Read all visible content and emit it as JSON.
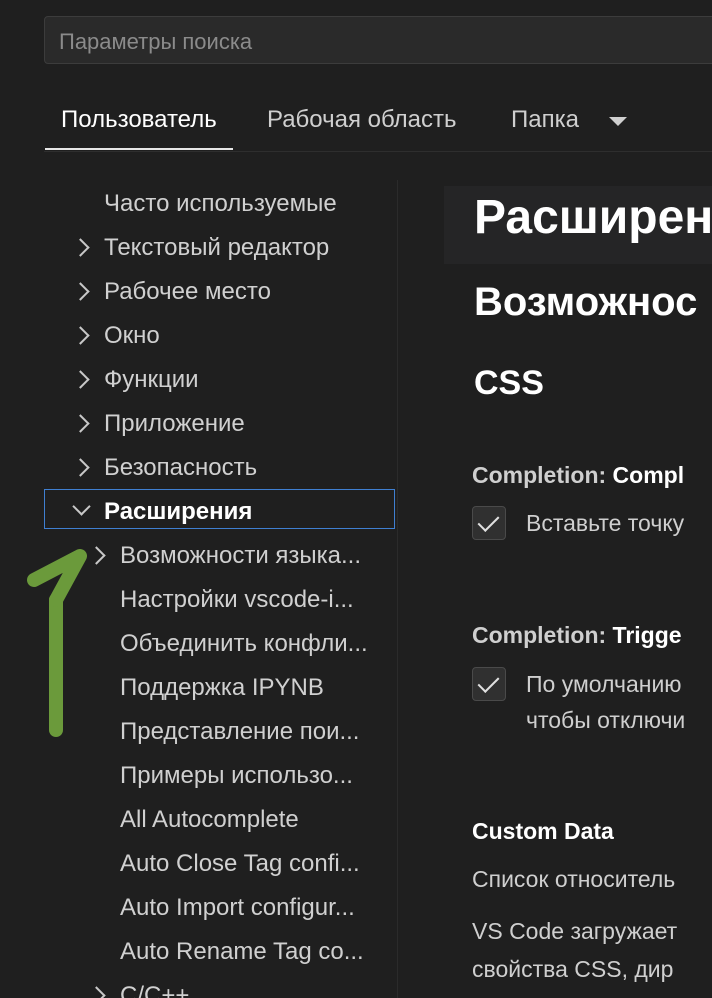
{
  "search": {
    "placeholder": "Параметры поиска"
  },
  "tabs": [
    {
      "label": "Пользователь"
    },
    {
      "label": "Рабочая область"
    },
    {
      "label": "Папка"
    }
  ],
  "tree": {
    "items": [
      {
        "label": "Часто используемые"
      },
      {
        "label": "Текстовый редактор"
      },
      {
        "label": "Рабочее место"
      },
      {
        "label": "Окно"
      },
      {
        "label": "Функции"
      },
      {
        "label": "Приложение"
      },
      {
        "label": "Безопасность"
      },
      {
        "label": "Расширения"
      }
    ],
    "extensions": [
      {
        "label": "Возможности языка..."
      },
      {
        "label": "Настройки vscode-i..."
      },
      {
        "label": "Объединить конфли..."
      },
      {
        "label": "Поддержка IPYNB"
      },
      {
        "label": "Представление пои..."
      },
      {
        "label": "Примеры использо..."
      },
      {
        "label": "All Autocomplete"
      },
      {
        "label": "Auto Close Tag confi..."
      },
      {
        "label": "Auto Import configur..."
      },
      {
        "label": "Auto Rename Tag co..."
      },
      {
        "label": "C/C++"
      }
    ]
  },
  "content": {
    "header": "Расширен",
    "section": "Возможнос",
    "subsection": "CSS",
    "settings": [
      {
        "category": "Completion: ",
        "name": "Compl",
        "description": [
          "Вставьте точку"
        ]
      },
      {
        "category": "Completion: ",
        "name": "Trigge",
        "description": [
          "По умолчанию",
          "чтобы отключи"
        ]
      }
    ],
    "custom_data": {
      "title": "Custom Data",
      "line1": "Список относитель",
      "line2": "VS Code загружает",
      "line3": "свойства CSS, дир"
    }
  },
  "colors": {
    "accent_border": "#3f7fd1",
    "arrow": "#6b9a3b"
  }
}
